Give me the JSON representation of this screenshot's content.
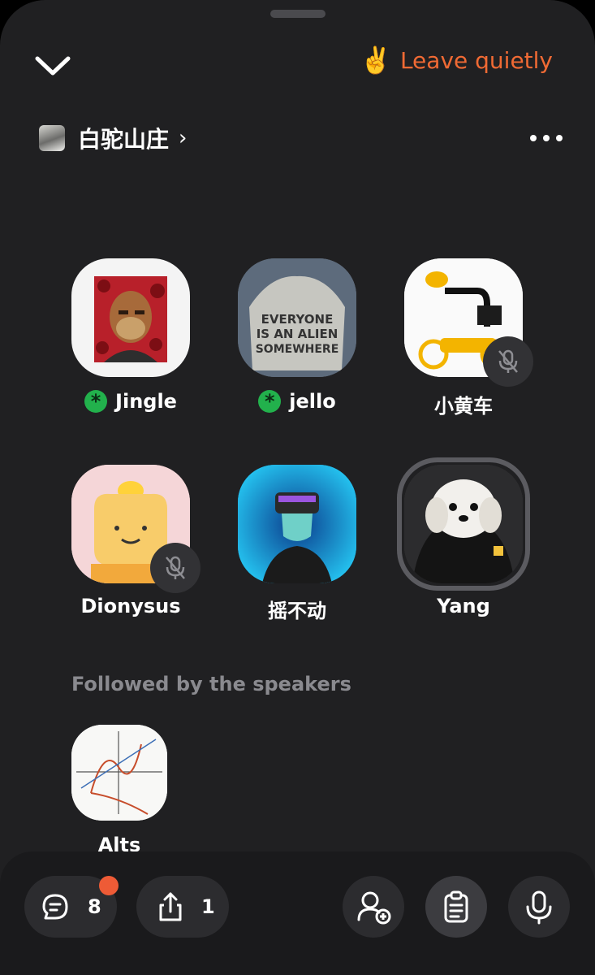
{
  "header": {
    "leave_emoji": "✌️",
    "leave_label": "Leave quietly"
  },
  "room": {
    "name": "白驼山庄",
    "arrow": "›"
  },
  "speakers": [
    {
      "name": "Jingle",
      "status": "star"
    },
    {
      "name": "jello",
      "status": "star"
    },
    {
      "name": "小黄车",
      "status": "muted"
    },
    {
      "name": "Dionysus",
      "status": "muted"
    },
    {
      "name": "摇不动",
      "status": "none"
    },
    {
      "name": "Yang",
      "status": "speaking"
    }
  ],
  "followed": {
    "title": "Followed by the speakers",
    "listeners": [
      {
        "name": "Alts"
      }
    ]
  },
  "toolbar": {
    "chat_count": "8",
    "share_count": "1"
  },
  "colors": {
    "accent": "#f06a34",
    "badge": "#ee5b36",
    "star": "#22b14c"
  }
}
